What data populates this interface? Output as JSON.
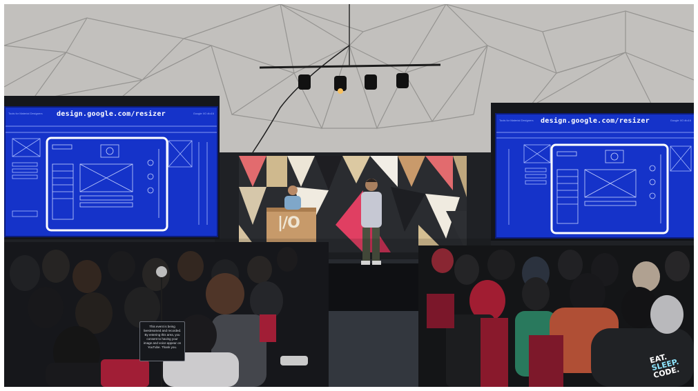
{
  "screens": {
    "left": {
      "url_text": "design.google.com/resizer",
      "meta_left": "Tools for Material Designers",
      "meta_right": "Google I/O #io16"
    },
    "right": {
      "url_text": "design.google.com/resizer",
      "meta_left": "Tools for Material Designers",
      "meta_right": "Google I/O #io16"
    }
  },
  "podium": {
    "logo_text": "|/O"
  },
  "notice_sign": {
    "text": "This event is being livestreamed and recorded. By entering this area, you consent to having your image and voice appear on YouTube. Thank you."
  },
  "hoodie": {
    "line1": "EAT.",
    "line2": "SLEEP.",
    "line3": "CODE."
  },
  "colors": {
    "screen_blue": "#1533c9",
    "dome_ceiling": "#c9c7c4",
    "stage_floor": "#3b3f47"
  }
}
